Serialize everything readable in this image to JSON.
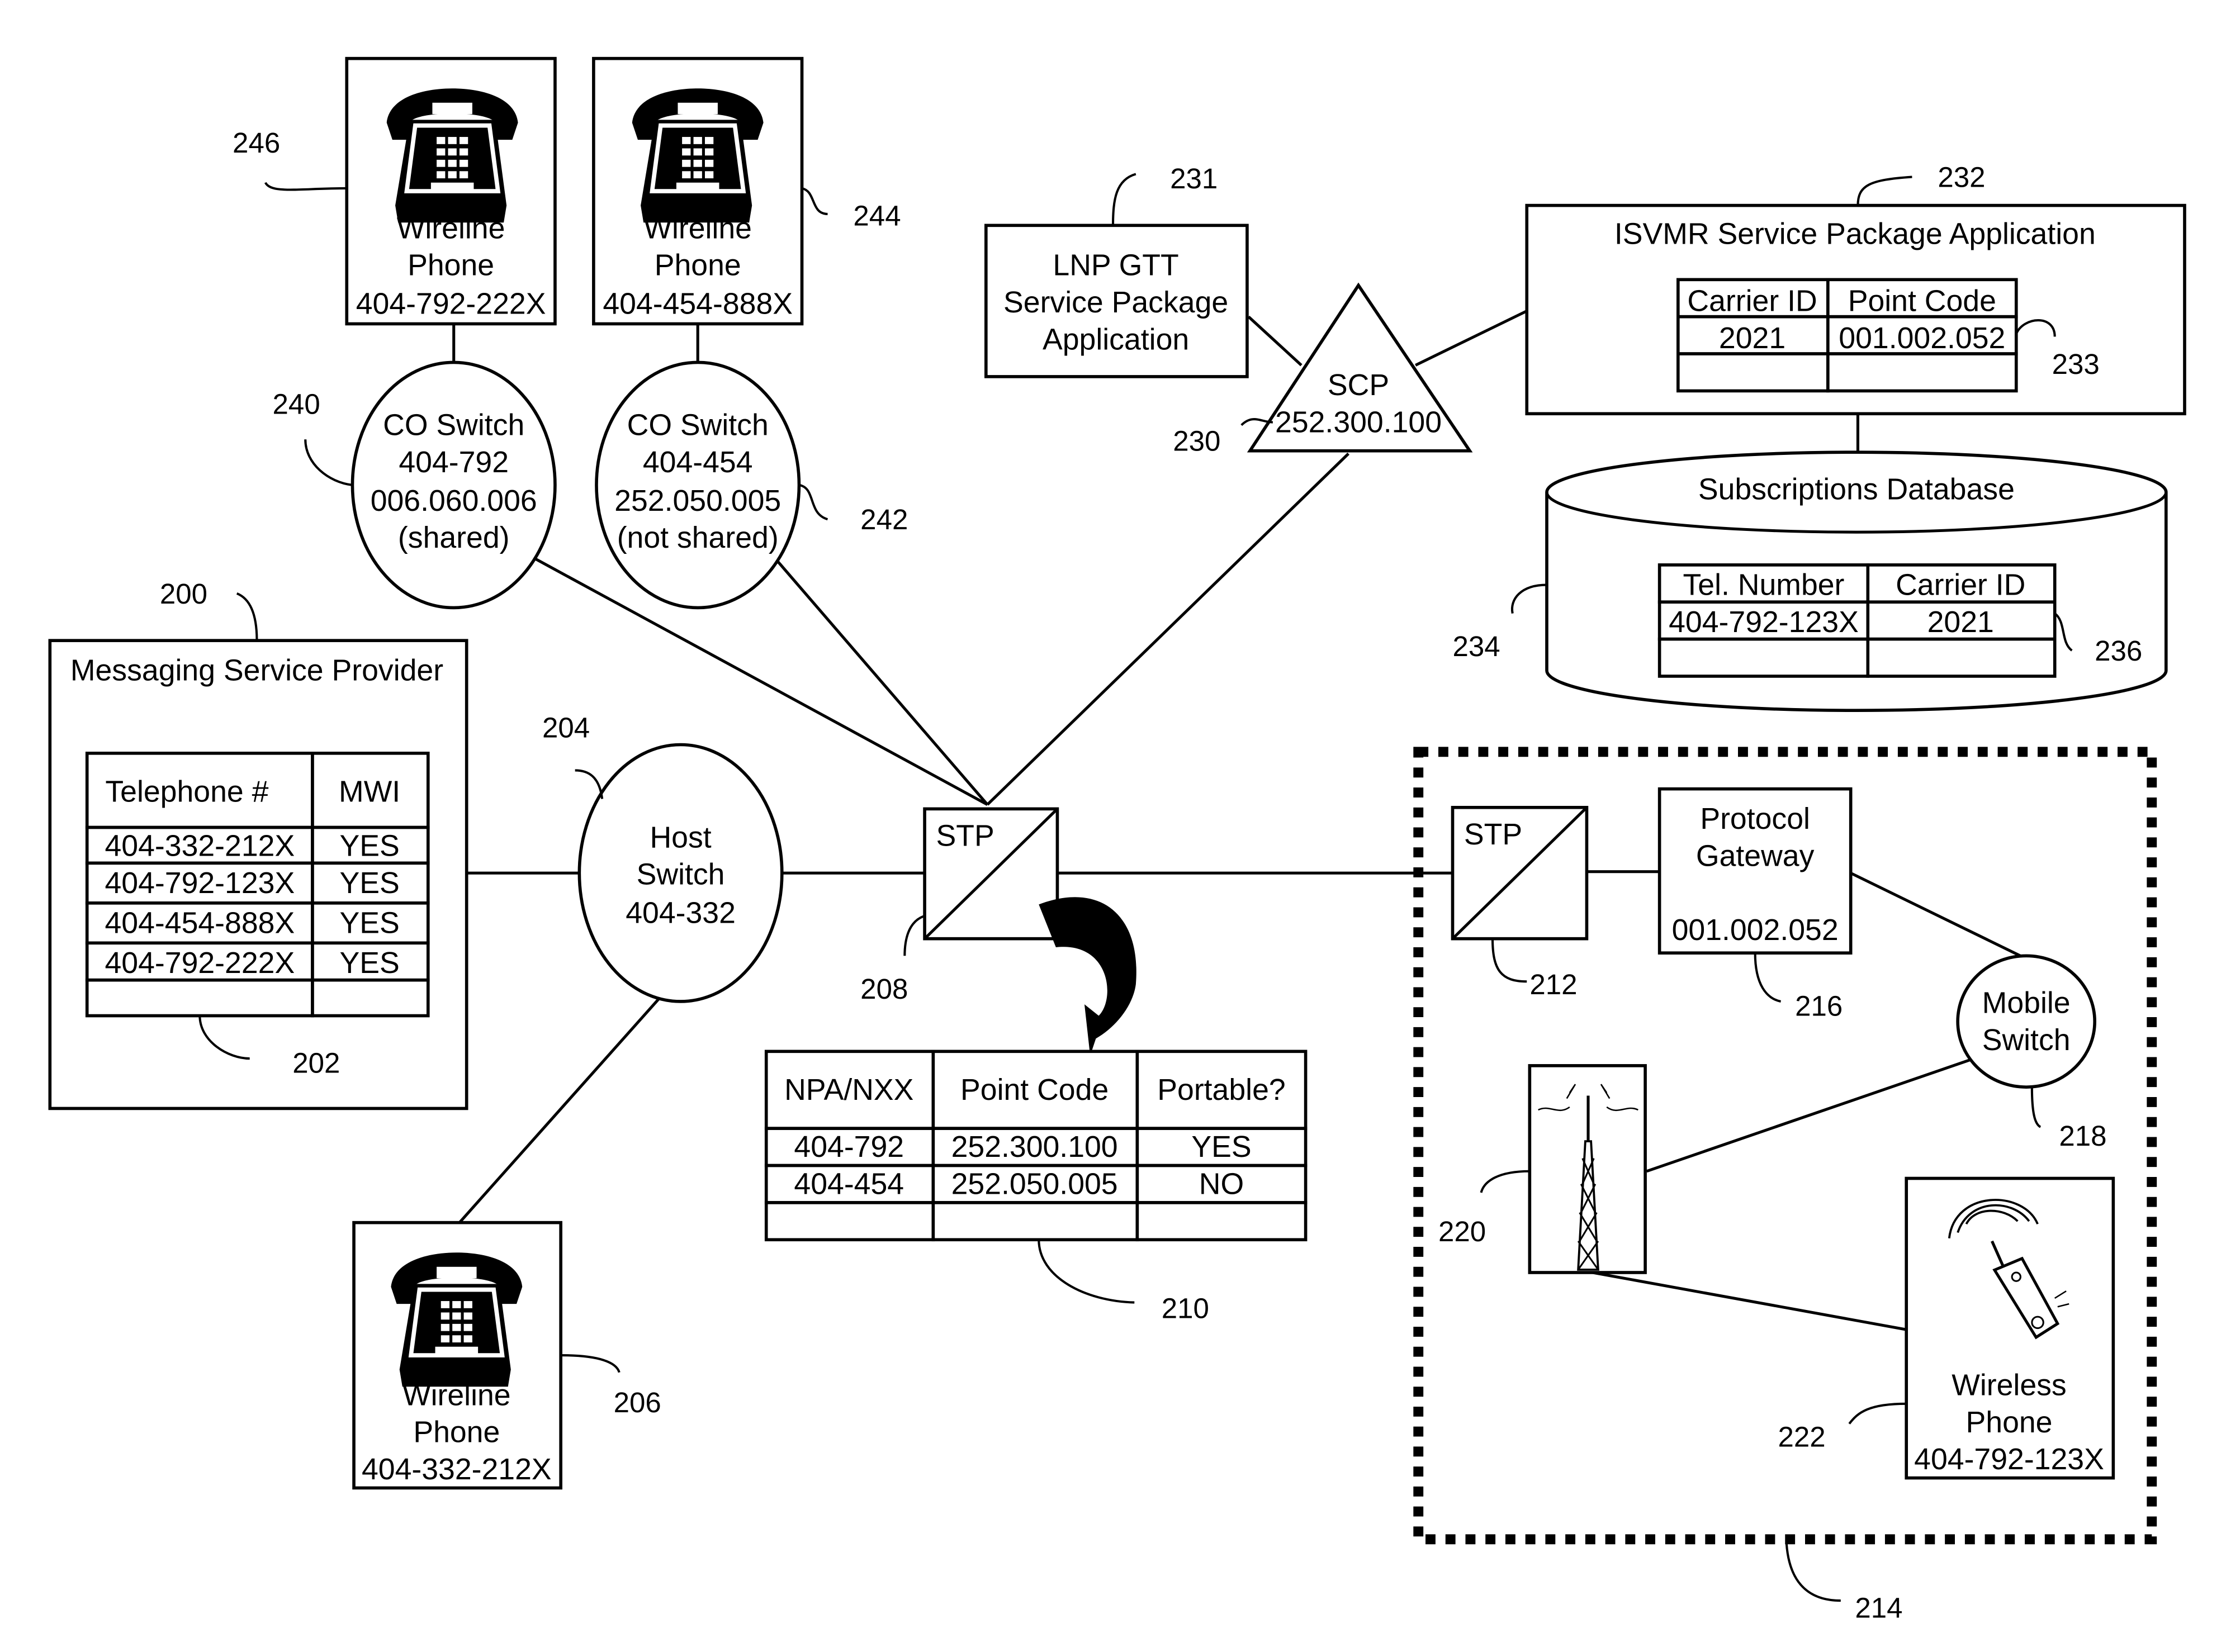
{
  "wireline_phone_246": {
    "ref": "246",
    "line1": "Wireline",
    "line2": "Phone",
    "number": "404-792-222X"
  },
  "wireline_phone_244": {
    "ref": "244",
    "line1": "Wireline",
    "line2": "Phone",
    "number": "404-454-888X"
  },
  "wireline_phone_206": {
    "ref": "206",
    "line1": "Wireline",
    "line2": "Phone",
    "number": "404-332-212X"
  },
  "co_switch_240": {
    "ref": "240",
    "line1": "CO Switch",
    "line2": "404-792",
    "line3": "006.060.006",
    "line4": "(shared)"
  },
  "co_switch_242": {
    "ref": "242",
    "line1": "CO Switch",
    "line2": "404-454",
    "line3": "252.050.005",
    "line4": "(not shared)"
  },
  "lnp_gtt_231": {
    "ref": "231",
    "line1": "LNP GTT",
    "line2": "Service Package",
    "line3": "Application"
  },
  "scp_230": {
    "ref": "230",
    "line1": "SCP",
    "line2": "252.300.100"
  },
  "isvmr_232": {
    "ref": "232",
    "title": "ISVMR Service Package Application",
    "table_ref": "233",
    "headers": [
      "Carrier ID",
      "Point Code"
    ],
    "rows": [
      [
        "2021",
        "001.002.052"
      ],
      [
        "",
        ""
      ]
    ]
  },
  "subscriptions_db_234": {
    "ref": "234",
    "title": "Subscriptions Database",
    "table_ref": "236",
    "headers": [
      "Tel. Number",
      "Carrier ID"
    ],
    "rows": [
      [
        "404-792-123X",
        "2021"
      ],
      [
        "",
        ""
      ]
    ]
  },
  "messaging_provider_200": {
    "ref": "200",
    "title": "Messaging Service Provider",
    "table_ref": "202",
    "headers": [
      "Telephone #",
      "MWI"
    ],
    "rows": [
      [
        "404-332-212X",
        "YES"
      ],
      [
        "404-792-123X",
        "YES"
      ],
      [
        "404-454-888X",
        "YES"
      ],
      [
        "404-792-222X",
        "YES"
      ],
      [
        "",
        ""
      ]
    ]
  },
  "host_switch_204": {
    "ref": "204",
    "line1": "Host",
    "line2": "Switch",
    "line3": "404-332"
  },
  "stp_208": {
    "ref": "208",
    "label": "STP"
  },
  "lnp_table_210": {
    "ref": "210",
    "headers": [
      "NPA/NXX",
      "Point Code",
      "Portable?"
    ],
    "rows": [
      [
        "404-792",
        "252.300.100",
        "YES"
      ],
      [
        "404-454",
        "252.050.005",
        "NO"
      ],
      [
        "",
        "",
        ""
      ]
    ]
  },
  "wireless_network_214": {
    "ref": "214"
  },
  "stp_212": {
    "ref": "212",
    "label": "STP"
  },
  "protocol_gateway_216": {
    "ref": "216",
    "line1": "Protocol",
    "line2": "Gateway",
    "line3": "001.002.052"
  },
  "mobile_switch_218": {
    "ref": "218",
    "line1": "Mobile",
    "line2": "Switch"
  },
  "cell_tower_220": {
    "ref": "220"
  },
  "wireless_phone_222": {
    "ref": "222",
    "line1": "Wireless",
    "line2": "Phone",
    "number": "404-792-123X"
  }
}
